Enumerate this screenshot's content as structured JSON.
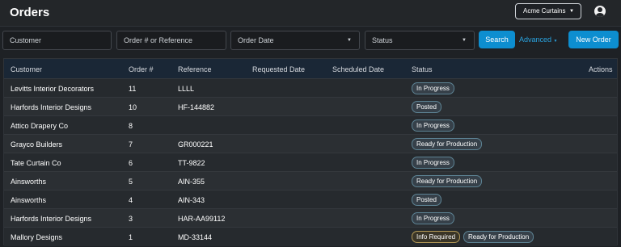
{
  "header": {
    "title": "Orders",
    "company": "Acme Curtains"
  },
  "filters": {
    "customer_placeholder": "Customer",
    "order_placeholder": "Order # or Reference",
    "date_label": "Order Date",
    "status_label": "Status",
    "search_label": "Search",
    "advanced_label": "Advanced",
    "new_order_label": "New Order"
  },
  "table": {
    "columns": [
      "Customer",
      "Order #",
      "Reference",
      "Requested Date",
      "Scheduled Date",
      "Status",
      "Actions"
    ],
    "rows": [
      {
        "customer": "Levitts Interior Decorators",
        "order": "11",
        "reference": "LLLL",
        "requested": "",
        "scheduled": "",
        "status": [
          "In Progress"
        ]
      },
      {
        "customer": "Harfords Interior Designs",
        "order": "10",
        "reference": "HF-144882",
        "requested": "",
        "scheduled": "",
        "status": [
          "Posted"
        ]
      },
      {
        "customer": "Attico Drapery Co",
        "order": "8",
        "reference": "",
        "requested": "",
        "scheduled": "",
        "status": [
          "In Progress"
        ]
      },
      {
        "customer": "Grayco Builders",
        "order": "7",
        "reference": "GR000221",
        "requested": "",
        "scheduled": "",
        "status": [
          "Ready for Production"
        ]
      },
      {
        "customer": "Tate Curtain Co",
        "order": "6",
        "reference": "TT-9822",
        "requested": "",
        "scheduled": "",
        "status": [
          "In Progress"
        ]
      },
      {
        "customer": "Ainsworths",
        "order": "5",
        "reference": "AIN-355",
        "requested": "",
        "scheduled": "",
        "status": [
          "Ready for Production"
        ]
      },
      {
        "customer": "Ainsworths",
        "order": "4",
        "reference": "AIN-343",
        "requested": "",
        "scheduled": "",
        "status": [
          "Posted"
        ]
      },
      {
        "customer": "Harfords Interior Designs",
        "order": "3",
        "reference": "HAR-AA99112",
        "requested": "",
        "scheduled": "",
        "status": [
          "In Progress"
        ]
      },
      {
        "customer": "Mallory Designs",
        "order": "1",
        "reference": "MD-33144",
        "requested": "",
        "scheduled": "",
        "status": [
          "Info Required",
          "Ready for Production"
        ]
      }
    ]
  },
  "colors": {
    "accent": "#0d8ed0",
    "link": "#2aa3e0",
    "badge_border": "#5d8394",
    "badge_warning_border": "#b49a58"
  },
  "icons": {
    "user": "user-circle-icon",
    "dropdown": "caret-down-icon"
  }
}
